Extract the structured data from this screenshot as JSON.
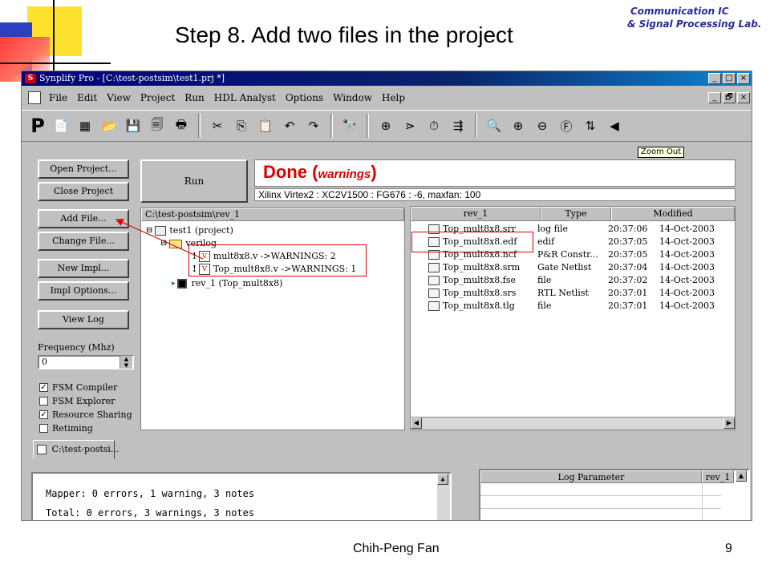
{
  "slide": {
    "title": "Step 8.  Add  two files in the project",
    "lab_line1": "Communication IC",
    "lab_line2": "& Signal Processing Lab.",
    "author": "Chih-Peng Fan",
    "page_number": "9"
  },
  "window": {
    "title": "Synplify Pro - [C:\\test-postsim\\test1.prj *]",
    "app_icon": "S",
    "buttons": [
      "_",
      "□",
      "×"
    ],
    "doc_buttons": [
      "_",
      "🗗",
      "×"
    ]
  },
  "menu": [
    "File",
    "Edit",
    "View",
    "Project",
    "Run",
    "HDL Analyst",
    "Options",
    "Window",
    "Help"
  ],
  "toolbar": {
    "p_label": "P",
    "icons": [
      "hdl-file-icon",
      "grid-icon",
      "open-folder-icon",
      "save-icon",
      "save-all-icon",
      "print-icon",
      "cut-icon",
      "copy-icon",
      "paste-icon",
      "undo-icon",
      "redo-icon",
      "find-icon",
      "add-icon",
      "rtl-view-icon",
      "timer-icon",
      "fsm-icon",
      "zoom-icon",
      "zoom-in-icon",
      "zoom-out-icon",
      "zoom-fit-icon",
      "push-icon",
      "back-icon"
    ],
    "tooltip": "Zoom Out"
  },
  "left_buttons": [
    "Open Project...",
    "Close Project",
    "Add File...",
    "Change File...",
    "New Impl...",
    "Impl Options...",
    "View Log"
  ],
  "run_label": "Run",
  "status": {
    "done": "Done",
    "warnings": "warnings",
    "device": "Xilinx Virtex2 : XC2V1500 : FG676 : -6,  maxfan: 100"
  },
  "frequency": {
    "label": "Frequency (Mhz)",
    "value": "0"
  },
  "checkboxes": [
    {
      "label": "FSM Compiler",
      "checked": true
    },
    {
      "label": "FSM Explorer",
      "checked": false
    },
    {
      "label": "Resource Sharing",
      "checked": true
    },
    {
      "label": "Retiming",
      "checked": false
    }
  ],
  "tree": {
    "header": "C:\\test-postsim\\rev_1",
    "project": "test1 (project)",
    "folder": "verilog",
    "file1": "mult8x8.v ->WARNINGS: 2",
    "file2": "Top_mult8x8.v ->WARNINGS: 1",
    "impl": "rev_1    (Top_mult8x8)",
    "expand_marks": [
      "⊟",
      "⊟"
    ]
  },
  "list": {
    "columns": [
      "rev_1",
      "Type",
      "Modified"
    ],
    "rows": [
      [
        "Top_mult8x8.srr",
        "log file",
        "20:37:06",
        "14-Oct-2003"
      ],
      [
        "Top_mult8x8.edf",
        "edif",
        "20:37:05",
        "14-Oct-2003"
      ],
      [
        "Top_mult8x8.ncf",
        "P&R Constr...",
        "20:37:05",
        "14-Oct-2003"
      ],
      [
        "Top_mult8x8.srm",
        "Gate Netlist",
        "20:37:04",
        "14-Oct-2003"
      ],
      [
        "Top_mult8x8.fse",
        "file",
        "20:37:02",
        "14-Oct-2003"
      ],
      [
        "Top_mult8x8.srs",
        "RTL Netlist",
        "20:37:01",
        "14-Oct-2003"
      ],
      [
        "Top_mult8x8.tlg",
        "file",
        "20:37:01",
        "14-Oct-2003"
      ]
    ]
  },
  "tab_label": "C:\\test-postsi...",
  "log": {
    "line1": "Mapper: 0 errors, 1 warning, 3 notes",
    "line2": "Total: 0 errors, 3 warnings, 3 notes"
  },
  "params": {
    "col1": "Log Parameter",
    "col2": "rev_1"
  },
  "colors": {
    "done_red": "#dd0000",
    "titlebar_blue": "#0a246a",
    "annotation_red": "#dd0000"
  }
}
